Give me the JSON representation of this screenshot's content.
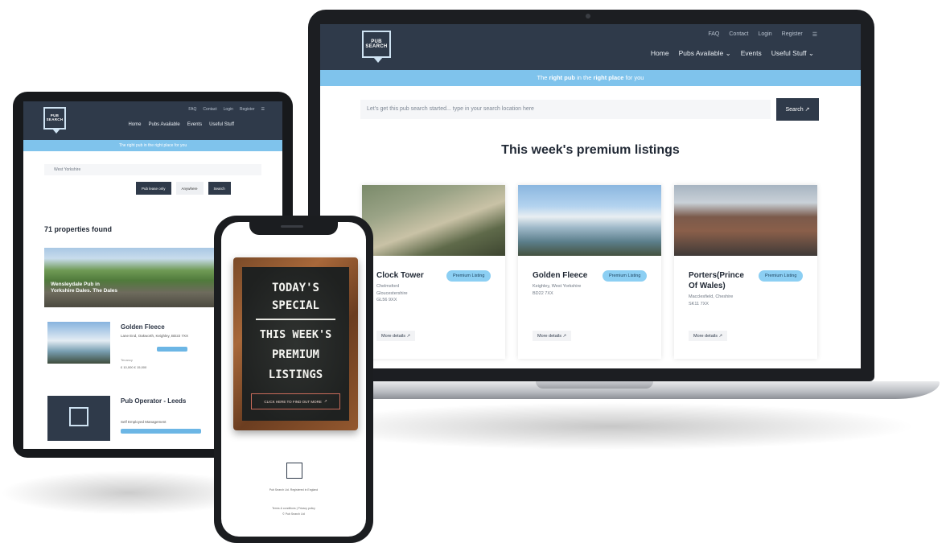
{
  "colors": {
    "nav": "#2f3a4a",
    "banner": "#7fc3ec",
    "pill": "#8ccff3"
  },
  "brand": {
    "logo_text": "PUB SEARCH"
  },
  "laptop": {
    "top_links": [
      "FAQ",
      "Contact",
      "Login",
      "Register"
    ],
    "top_icon": "menu-icon",
    "main_nav": [
      "Home",
      "Pubs Available",
      "Events",
      "Useful Stuff"
    ],
    "banner_pre": "The ",
    "banner_b1": "right pub",
    "banner_mid": " in the ",
    "banner_b2": "right place",
    "banner_post": " for you",
    "search_placeholder": "Let's get this pub search started... type in your search location here",
    "search_button": "Search",
    "heading": "This week's premium listings",
    "cards": [
      {
        "title": "Clock Tower",
        "badge": "Premium Listing",
        "address": [
          "Chelmsford",
          "Gloucestershire",
          "GL56 9XX"
        ],
        "more": "More details"
      },
      {
        "title": "Golden Fleece",
        "badge": "Premium Listing",
        "address": [
          "Keighley, West Yorkshire",
          "BD22 7XX"
        ],
        "more": "More details"
      },
      {
        "title": "Porters(Prince Of Wales)",
        "badge": "Premium Listing",
        "address": [
          "Macclesfield, Cheshire",
          "SK11 7XX"
        ],
        "more": "More details"
      }
    ]
  },
  "tablet": {
    "top_links": [
      "FAQ",
      "Contact",
      "Login",
      "Register"
    ],
    "main_nav": [
      "Home",
      "Pubs Available",
      "Events",
      "Useful Stuff"
    ],
    "banner": "The right pub in the right place for you",
    "search_value": "West Yorkshire",
    "filters": [
      "Pub lease only",
      "Anywhere",
      "Search"
    ],
    "count": "71 properties found",
    "hero_text": [
      "Wensleydale Pub in",
      "Yorkshire Dales. The Dales"
    ],
    "item1": {
      "title": "Golden Fleece",
      "sub": "Lane End, Oakworth, Keighley, BD22 7XX",
      "meta": "Tenancy",
      "price": "£ 10,000    £ 15,000"
    },
    "item2": {
      "title": "Pub Operator - Leeds",
      "sub": "Self Employed Management"
    }
  },
  "phone": {
    "chalk_lines": [
      "TODAY'S",
      "SPECIAL",
      "THIS WEEK'S",
      "PREMIUM",
      "LISTINGS"
    ],
    "cta": "CLICK HERE TO FIND OUT MORE",
    "footer_line_1": "Pub Search Ltd. Registered in England",
    "footer_line_2": "Terms & conditions | Privacy policy",
    "footer_line_3": "© Pub Search Ltd"
  }
}
